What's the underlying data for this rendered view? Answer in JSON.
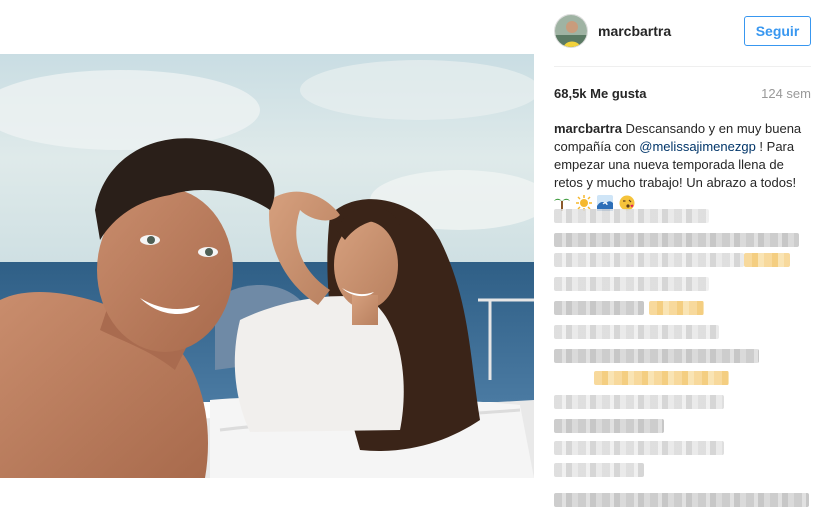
{
  "post": {
    "username": "marcbartra",
    "follow_label": "Seguir",
    "likes": "68,5k Me gusta",
    "age": "124 sem",
    "caption": {
      "username": "marcbartra",
      "text_before": " Descansando y en muy buena compañía con ",
      "mention": "@melissajimenezgp",
      "text_after": " ! Para empezar una nueva temporada llena de retos y mucho trabajo! Un abrazo a todos!",
      "emojis": [
        "palm-tree-emoji",
        "sun-emoji",
        "wave-emoji",
        "kiss-emoji"
      ]
    }
  },
  "colors": {
    "accent": "#3897f0",
    "mention": "#003569",
    "muted": "#999999",
    "text": "#262626"
  }
}
